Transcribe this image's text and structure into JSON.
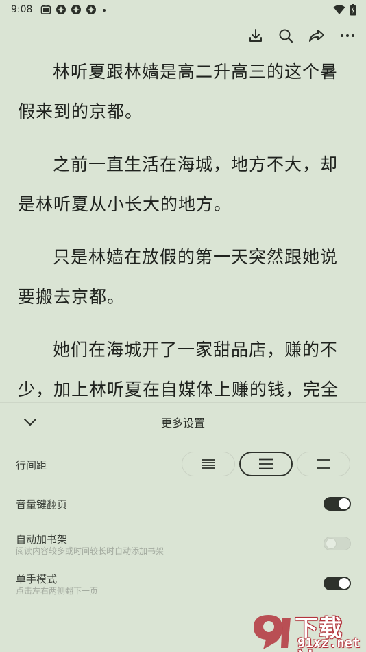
{
  "status_bar": {
    "time": "9:08",
    "left_icons": [
      "alarm-clock-icon",
      "app-notification-icon",
      "app-notification-icon",
      "app-notification-icon",
      "more-dot-icon"
    ],
    "right_icons": [
      "wifi-icon",
      "battery-icon"
    ]
  },
  "toolbar": {
    "icons": [
      "download-icon",
      "search-icon",
      "share-icon",
      "more-icon"
    ]
  },
  "reader": {
    "paragraphs": [
      "林听夏跟林嫱是高二升高三的这个暑假来到的京都。",
      "之前一直生活在海城，地方不大，却是林听夏从小长大的地方。",
      "只是林嫱在放假的第一天突然跟她说要搬去京都。",
      "她们在海城开了一家甜品店，赚的不少，加上林听夏在自媒体上赚的钱，完全能"
    ]
  },
  "panel": {
    "title": "更多设置",
    "line_spacing": {
      "label": "行间距",
      "options": [
        "compact-spacing",
        "medium-spacing",
        "loose-spacing"
      ],
      "selected": 1
    },
    "volume_key_page": {
      "label": "音量键翻页",
      "on": true
    },
    "auto_bookshelf": {
      "label": "自动加书架",
      "sublabel": "阅读内容较多或时间较长时自动添加书架",
      "on": false
    },
    "one_hand_mode": {
      "label": "单手模式",
      "sublabel": "点击左右两侧翻下一页",
      "on": true
    }
  },
  "watermark": {
    "main": "下载站",
    "sub": "91xz.net",
    "brand_color": "#b3353d"
  },
  "colors": {
    "background": "#dae4d4",
    "text": "#1f221e",
    "toggle_on": "#2e322c"
  }
}
